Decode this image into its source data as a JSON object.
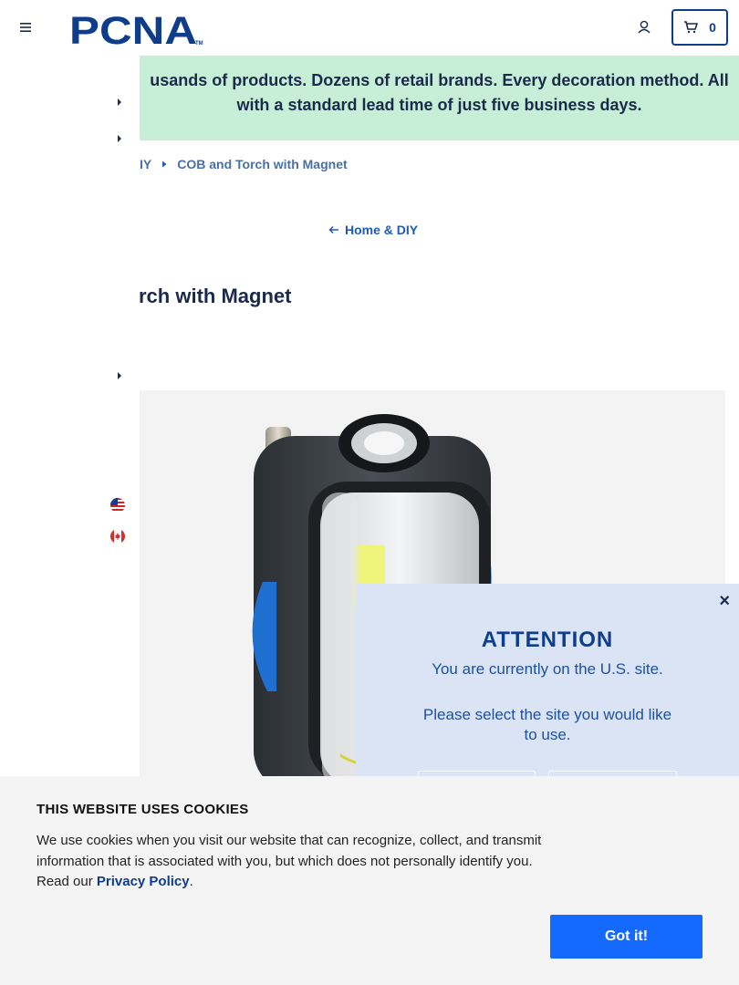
{
  "header": {
    "logo_text": "PCNA",
    "logo_tm": "TM",
    "cart_count": "0"
  },
  "banner": {
    "line1": "usands of products. Dozens of retail brands. Every decoration method. All",
    "line2": "with a standard lead time of just five business days."
  },
  "breadcrumb": {
    "parent": "IY",
    "current": "COB and Torch with Magnet"
  },
  "back_link": {
    "label": "Home & DIY"
  },
  "product": {
    "title": "rch with Magnet"
  },
  "modal": {
    "close": "×",
    "title": "ATTENTION",
    "line1": "You are currently on the U.S. site.",
    "line2": "Please select the site you would like to use."
  },
  "cookies": {
    "title": "THIS WEBSITE USES COOKIES",
    "text": "We use cookies when you visit our website that can recognize, collect, and transmit information that is associated with you, but which does not personally identify you. Read our ",
    "link": "Privacy Policy",
    "period": ".",
    "button": "Got it!"
  },
  "colors": {
    "brand_blue": "#0e3d8c",
    "banner_green": "#c7efd7",
    "modal_bg": "#dae4f4",
    "cookie_button": "#1469ff"
  },
  "icons": [
    "hamburger-icon",
    "account-icon",
    "cart-icon",
    "chevron-right-icon",
    "us-flag-icon",
    "ca-flag-icon",
    "arrow-left-icon",
    "close-icon"
  ]
}
